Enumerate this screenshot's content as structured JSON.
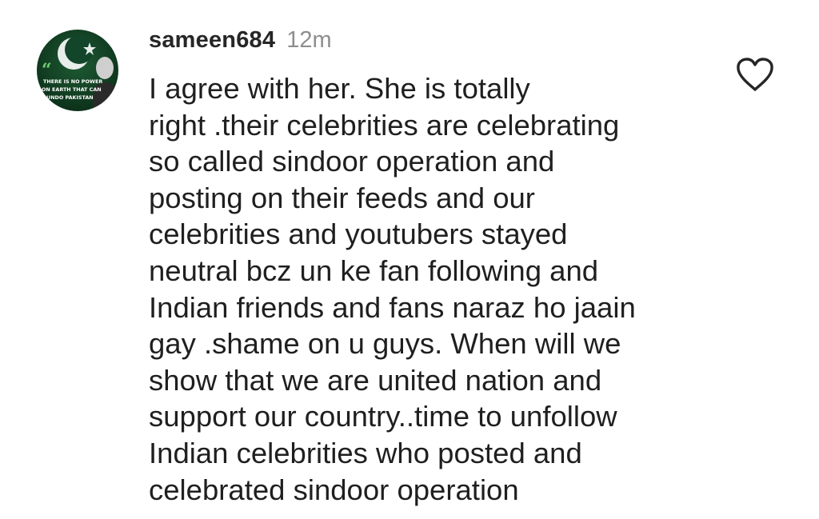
{
  "comment": {
    "username": "sameen684",
    "time": "12m",
    "text": "I agree with her. She is totally\nright .their celebrities are celebrating\nso called sindoor operation and\nposting on their feeds and our\ncelebrities and youtubers stayed\nneutral bcz un ke fan following and\nIndian friends and fans naraz ho jaain\ngay .shame on u guys. When will we\nshow that we are united nation and\nsupport our country..time to unfollow\nIndian celebrities who posted and\ncelebrated sindoor operation",
    "liked": false
  },
  "avatar": {
    "quote_mark": "“",
    "lines": [
      "THERE IS NO POWER",
      "ON EARTH THAT CAN",
      "UNDO PAKISTAN"
    ],
    "colors": {
      "green": "#0b4a26",
      "dark": "#14331f",
      "white": "#ffffff"
    }
  },
  "icons": {
    "like": "heart-outline-icon"
  }
}
